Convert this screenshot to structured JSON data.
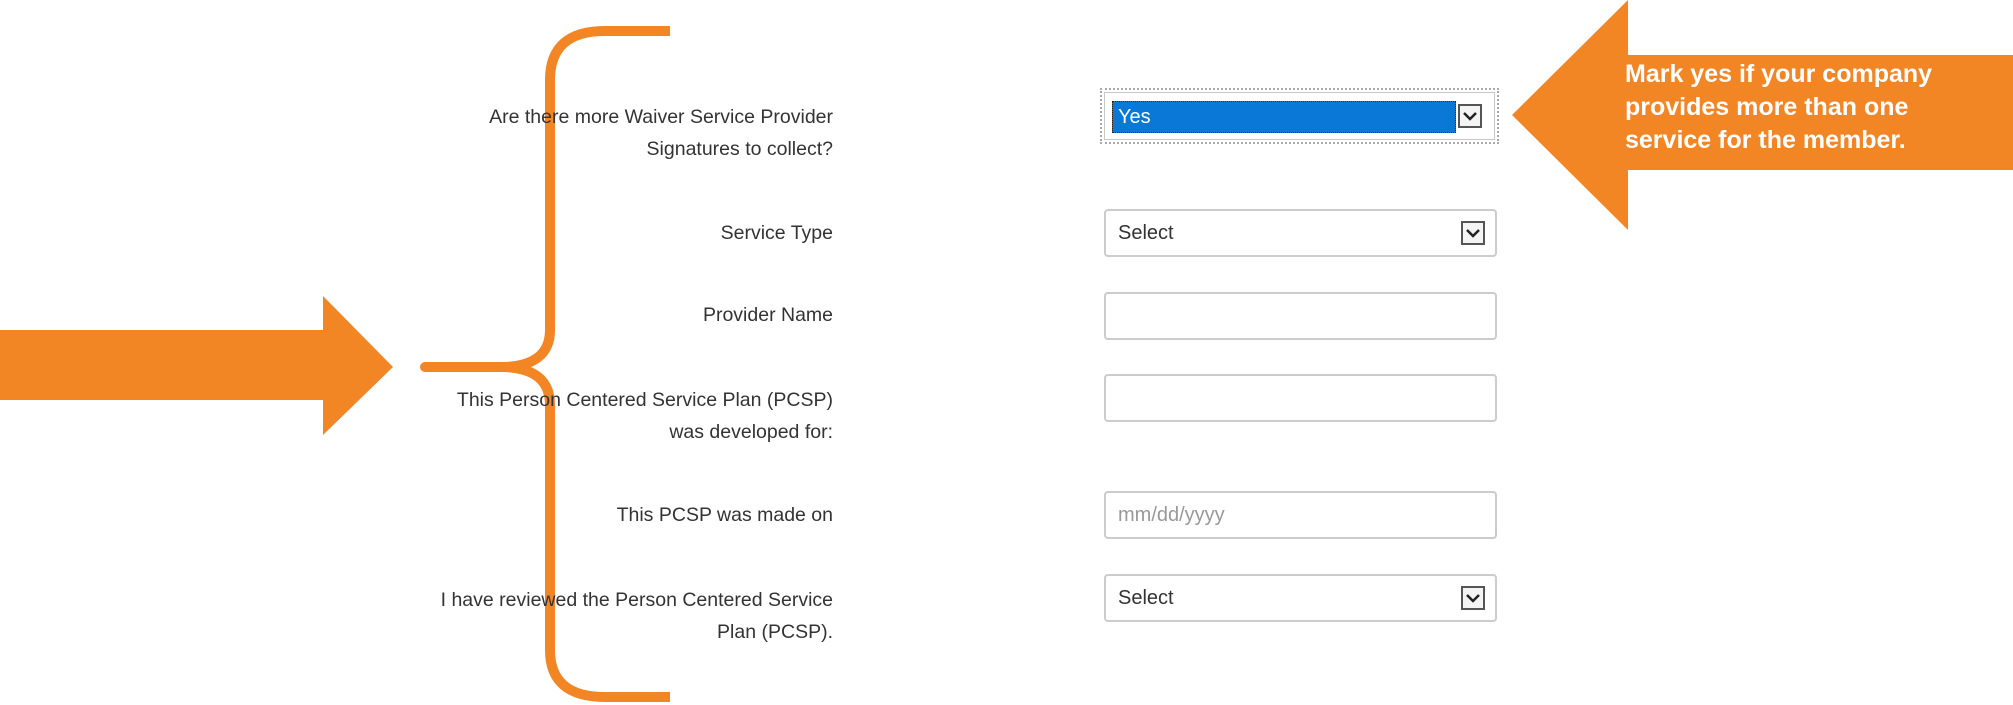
{
  "form": {
    "waiver_question": {
      "label_line1": "Are there more Waiver Service Provider",
      "label_line2": "Signatures to collect?",
      "selected_value": "Yes"
    },
    "service_type": {
      "label": "Service Type",
      "selected_value": "Select"
    },
    "provider_name": {
      "label": "Provider Name",
      "value": ""
    },
    "pcsp_developed_for": {
      "label_line1": "This Person Centered Service Plan (PCSP)",
      "label_line2": "was developed for:",
      "value": ""
    },
    "pcsp_made_on": {
      "label": "This PCSP was made on",
      "placeholder": "mm/dd/yyyy"
    },
    "reviewed_pcsp": {
      "label_line1": "I have reviewed the Person Centered Service",
      "label_line2": "Plan (PCSP).",
      "selected_value": "Select"
    }
  },
  "annotations": {
    "callout_lines": [
      "Mark yes if your company",
      "provides more than one",
      "service for the member."
    ],
    "accent_color": "#f28524",
    "selection_color": "#0a78d7"
  },
  "icons": {
    "dropdown": "chevron-down-icon",
    "left_arrow": "arrow-right-icon",
    "callout_arrow": "arrow-left-icon",
    "brace": "curly-brace-icon"
  }
}
